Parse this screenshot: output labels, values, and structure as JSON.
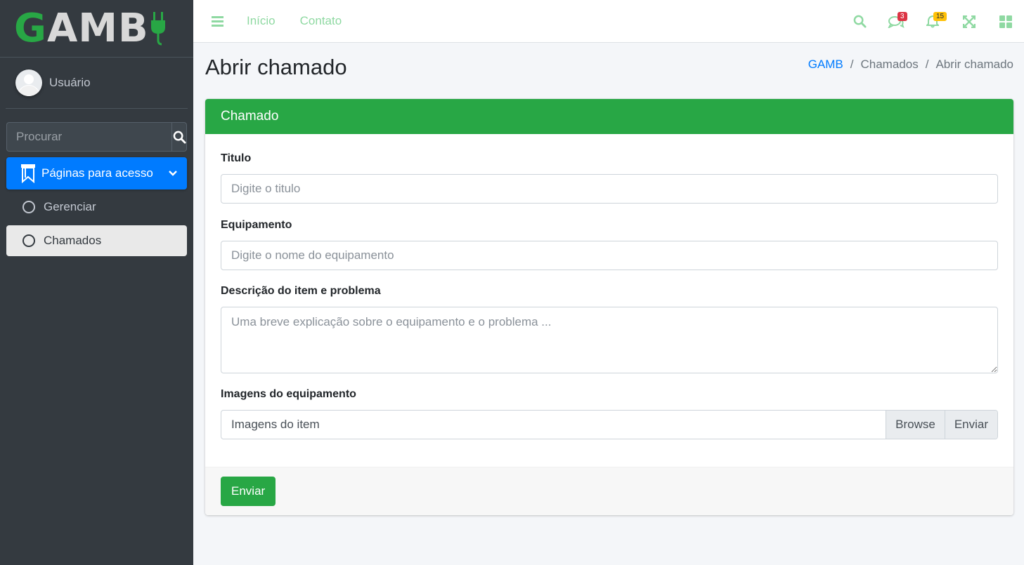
{
  "brand": {
    "logo_text": "GAMB",
    "colors": {
      "accent": "#28a745",
      "letters": "#d8d8d8"
    }
  },
  "sidebar": {
    "user_name": "Usuário",
    "search_placeholder": "Procurar",
    "nav_main_label": "Páginas para acesso",
    "nav_items": [
      {
        "label": "Gerenciar",
        "active": false
      },
      {
        "label": "Chamados",
        "active": true
      }
    ]
  },
  "topbar": {
    "links": [
      "Início",
      "Contato"
    ],
    "messages_badge": "3",
    "notifications_badge": "15"
  },
  "page": {
    "title": "Abrir chamado",
    "breadcrumb": [
      "GAMB",
      "Chamados",
      "Abrir chamado"
    ]
  },
  "card": {
    "header": "Chamado",
    "fields": {
      "titulo_label": "Titulo",
      "titulo_placeholder": "Digite o titulo",
      "equip_label": "Equipamento",
      "equip_placeholder": "Digite o nome do equipamento",
      "desc_label": "Descrição do item e problema",
      "desc_placeholder": "Uma breve explicação sobre o equipamento e o problema ...",
      "images_label": "Imagens do equipamento",
      "images_file_label": "Imagens do item",
      "browse_label": "Browse",
      "upload_label": "Enviar"
    },
    "submit_label": "Enviar"
  },
  "colors": {
    "primary": "#007bff",
    "success": "#28a745",
    "sidebar_bg": "#343a40",
    "danger": "#dc3545",
    "warning": "#ffc107"
  }
}
